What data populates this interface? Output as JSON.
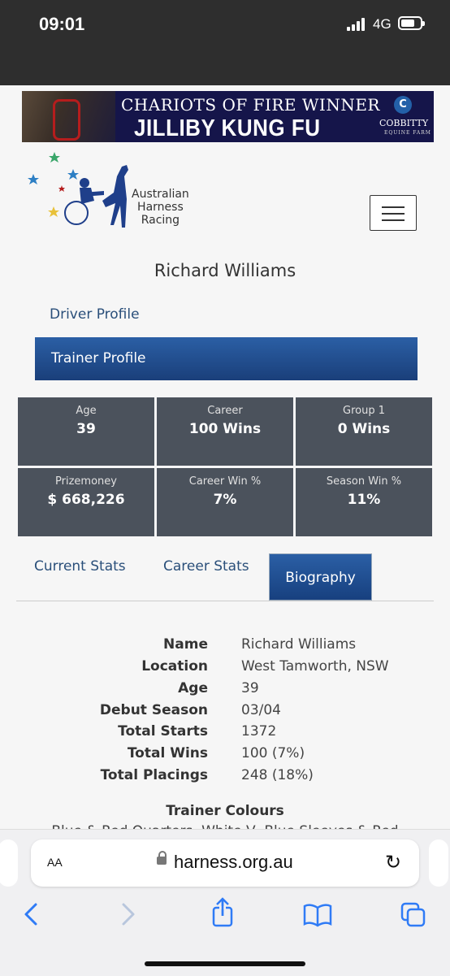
{
  "status": {
    "time": "09:01",
    "network": "4G"
  },
  "banner": {
    "line1": "CHARIOTS OF FIRE WINNER",
    "line2": "JILLIBY KUNG FU",
    "sponsor": "COBBITTY",
    "sponsor_sub": "EQUINE FARM",
    "sponsor_logo": "C"
  },
  "logo": {
    "line1": "Australian",
    "line2": "Harness",
    "line3": "Racing"
  },
  "profile": {
    "name": "Richard Williams",
    "driver_link": "Driver Profile",
    "trainer_tab": "Trainer Profile"
  },
  "stats": [
    {
      "label": "Age",
      "value": "39"
    },
    {
      "label": "Career",
      "value": "100 Wins"
    },
    {
      "label": "Group 1",
      "value": "0 Wins"
    },
    {
      "label": "Prizemoney",
      "value": "$ 668,226"
    },
    {
      "label": "Career Win %",
      "value": "7%"
    },
    {
      "label": "Season Win %",
      "value": "11%"
    }
  ],
  "tabs": {
    "current": "Current Stats",
    "career": "Career Stats",
    "bio": "Biography"
  },
  "bio": [
    {
      "k": "Name",
      "v": "Richard Williams"
    },
    {
      "k": "Location",
      "v": "West Tamworth, NSW"
    },
    {
      "k": "Age",
      "v": "39"
    },
    {
      "k": "Debut Season",
      "v": "03/04"
    },
    {
      "k": "Total Starts",
      "v": "1372"
    },
    {
      "k": "Total Wins",
      "v": "100 (7%)"
    },
    {
      "k": "Total Placings",
      "v": "248 (18%)"
    }
  ],
  "colours": {
    "heading": "Trainer Colours",
    "text": "Blue & Red Quarters, White V, Blue Sleeves & Red"
  },
  "browser": {
    "aa": "AA",
    "url": "harness.org.au"
  },
  "colors": {
    "accent": "#1f4f95",
    "stat_bg": "#4b525c",
    "ios_blue": "#2f7bf6"
  }
}
